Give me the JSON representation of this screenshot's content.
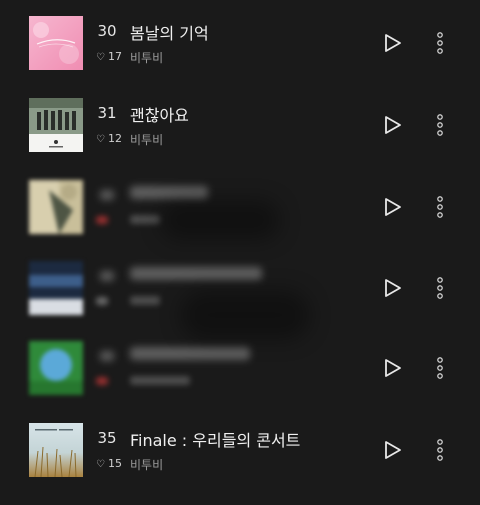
{
  "tracks": [
    {
      "rank": "30",
      "title": "봄날의 기억",
      "likes": "17",
      "artist": "비투비",
      "legible": true
    },
    {
      "rank": "31",
      "title": "괜찮아요",
      "likes": "12",
      "artist": "비투비",
      "legible": true
    },
    {
      "rank": "",
      "title": "",
      "likes": "",
      "artist": "",
      "legible": false
    },
    {
      "rank": "",
      "title": "",
      "likes": "",
      "artist": "",
      "legible": false
    },
    {
      "rank": "",
      "title": "",
      "likes": "",
      "artist": "",
      "legible": false
    },
    {
      "rank": "35",
      "title": "Finale : 우리들의 콘서트",
      "likes": "15",
      "artist": "비투비",
      "legible": true
    }
  ],
  "icons": {
    "heart": "heart-outline-icon",
    "play": "play-icon",
    "more": "more-vertical-icon"
  },
  "colors": {
    "background": "#1a1a1a",
    "text_primary": "#f0f0f0",
    "text_secondary": "#9a9a9a"
  }
}
